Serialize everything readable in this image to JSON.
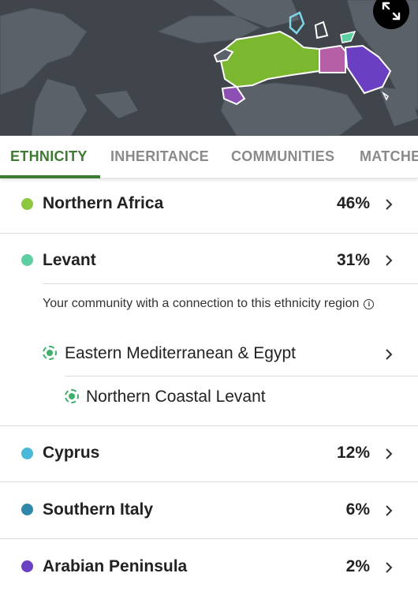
{
  "map": {
    "expand_icon": "expand-arrows-icon",
    "colors": {
      "ocean": "#3f454b",
      "land": "#5b6168",
      "northern_africa": "#7cb82f",
      "egypt": "#b55fa6",
      "arabian_peninsula": "#6a3fc1",
      "outline": "#ffffff"
    }
  },
  "tabs": [
    {
      "label": "ETHNICITY",
      "active": true
    },
    {
      "label": "INHERITANCE",
      "active": false
    },
    {
      "label": "COMMUNITIES",
      "active": false
    },
    {
      "label": "MATCHES",
      "active": false
    }
  ],
  "regions": [
    {
      "name": "Northern Africa",
      "percent": "46%",
      "color": "#8dc63f"
    },
    {
      "name": "Levant",
      "percent": "31%",
      "color": "#5fcfa3"
    },
    {
      "name": "Cyprus",
      "percent": "12%",
      "color": "#4ab8d6"
    },
    {
      "name": "Southern Italy",
      "percent": "6%",
      "color": "#2f88a8"
    },
    {
      "name": "Arabian Peninsula",
      "percent": "2%",
      "color": "#6a3fc1"
    }
  ],
  "community_section": {
    "intro": "Your community with a connection to this ethnicity region",
    "info_icon": "info-icon",
    "communities": [
      {
        "name": "Eastern Mediterranean & Egypt",
        "has_chevron": true
      },
      {
        "name": "Northern Coastal Levant",
        "has_chevron": false
      }
    ]
  }
}
